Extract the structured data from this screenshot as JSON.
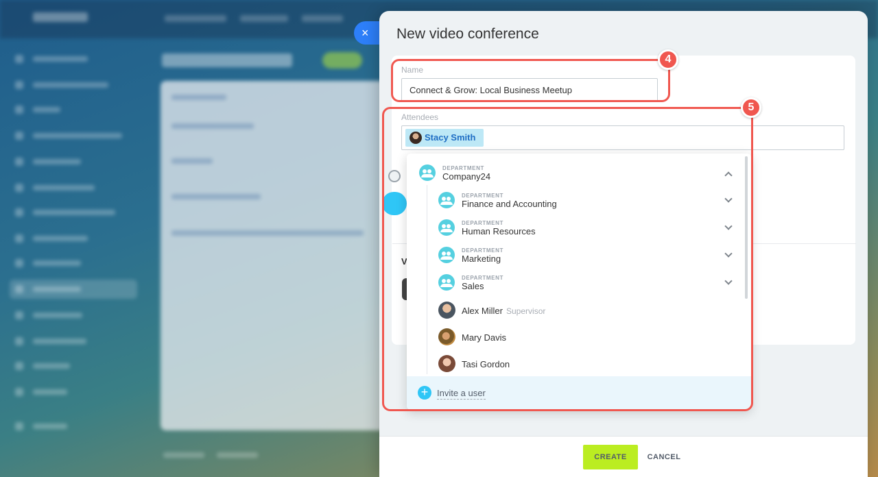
{
  "slider": {
    "title": "New video conference",
    "close_icon": "×"
  },
  "form": {
    "name_label": "Name",
    "name_value": "Connect & Grow: Local Business Meetup",
    "attendees_label": "Attendees",
    "chip_name": "Stacy Smith",
    "partial_text": "V"
  },
  "dropdown": {
    "root": {
      "kind": "DEPARTMENT",
      "name": "Company24"
    },
    "departments": [
      {
        "kind": "DEPARTMENT",
        "name": "Finance and Accounting"
      },
      {
        "kind": "DEPARTMENT",
        "name": "Human Resources"
      },
      {
        "kind": "DEPARTMENT",
        "name": "Marketing"
      },
      {
        "kind": "DEPARTMENT",
        "name": "Sales"
      }
    ],
    "people": [
      {
        "name": "Alex Miller",
        "role": "Supervisor"
      },
      {
        "name": "Mary Davis",
        "role": ""
      },
      {
        "name": "Tasi Gordon",
        "role": ""
      }
    ],
    "invite_label": "Invite a user",
    "invite_icon": "+"
  },
  "footer": {
    "create_label": "CREATE",
    "cancel_label": "CANCEL"
  },
  "annotations": {
    "name_step": "4",
    "attendees_step": "5"
  },
  "colors": {
    "accent_blue": "#2d7ff9",
    "create_green": "#bbed21",
    "callout_red": "#f0574f",
    "department_teal": "#55d0e0"
  }
}
